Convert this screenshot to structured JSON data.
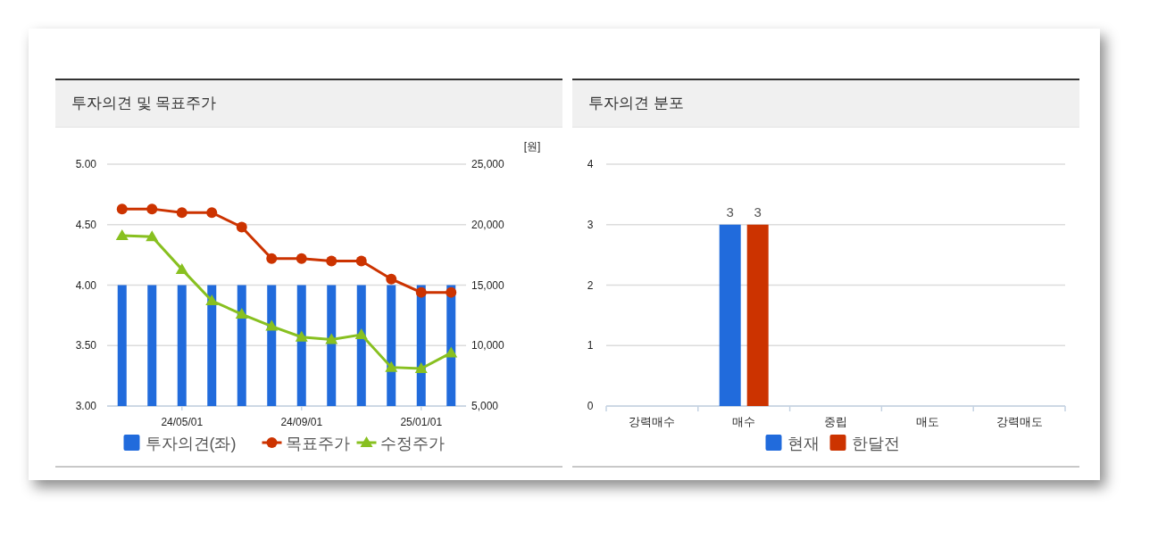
{
  "panels": [
    {
      "title": "투자의견 및 목표주가",
      "chart_data": {
        "type": "bar",
        "grid": true,
        "legend": "bottom",
        "ylim": [
          3,
          5
        ],
        "yticks": [
          {
            "value": 3,
            "label": "3.00"
          },
          {
            "value": 3.5,
            "label": "3.50"
          },
          {
            "value": 4,
            "label": "4.00"
          },
          {
            "value": 4.5,
            "label": "4.50"
          },
          {
            "value": 5,
            "label": "5.00"
          }
        ],
        "y2label": "[원]",
        "y2lim": [
          5000,
          25000
        ],
        "y2ticks": [
          {
            "value": 5000,
            "label": "5,000"
          },
          {
            "value": 10000,
            "label": "10,000"
          },
          {
            "value": 15000,
            "label": "15,000"
          },
          {
            "value": 20000,
            "label": "20,000"
          },
          {
            "value": 25000,
            "label": "25,000"
          }
        ],
        "categories": [
          null,
          null,
          "24/05/01",
          null,
          null,
          null,
          "24/09/01",
          null,
          null,
          null,
          "25/01/01",
          null
        ],
        "series": [
          {
            "name": "투자의견(좌)",
            "type": "bar",
            "color": "#216bdc",
            "values": [
              4,
              4,
              4,
              4,
              4,
              4,
              4,
              4,
              4,
              4,
              4,
              4
            ]
          },
          {
            "name": "목표주가",
            "type": "line",
            "marker": "circle",
            "axis": "y2",
            "color": "#cc3300",
            "values": [
              21300,
              21300,
              21000,
              21000,
              19800,
              17200,
              17200,
              17000,
              17000,
              15500,
              14400,
              14400
            ]
          },
          {
            "name": "수정주가",
            "type": "line",
            "marker": "triangle",
            "axis": "y2",
            "color": "#88c020",
            "values": [
              19100,
              19000,
              16300,
              13700,
              12600,
              11600,
              10700,
              10500,
              10900,
              8200,
              8100,
              9400
            ]
          }
        ]
      }
    },
    {
      "title": "투자의견 분포",
      "chart_data": {
        "type": "bar",
        "grid": true,
        "legend": "bottom",
        "ylim": [
          0,
          4
        ],
        "yticks": [
          0,
          1,
          2,
          3,
          4
        ],
        "categories": [
          "강력매수",
          "매수",
          "중립",
          "매도",
          "강력매도"
        ],
        "value_labels": [
          [
            null,
            "3",
            null,
            null,
            null
          ],
          [
            null,
            "3",
            null,
            null,
            null
          ]
        ],
        "series": [
          {
            "name": "현재",
            "color": "#216bdc",
            "values": [
              0,
              3,
              0,
              0,
              0
            ]
          },
          {
            "name": "한달전",
            "color": "#cc3300",
            "values": [
              0,
              3,
              0,
              0,
              0
            ]
          }
        ]
      }
    }
  ]
}
